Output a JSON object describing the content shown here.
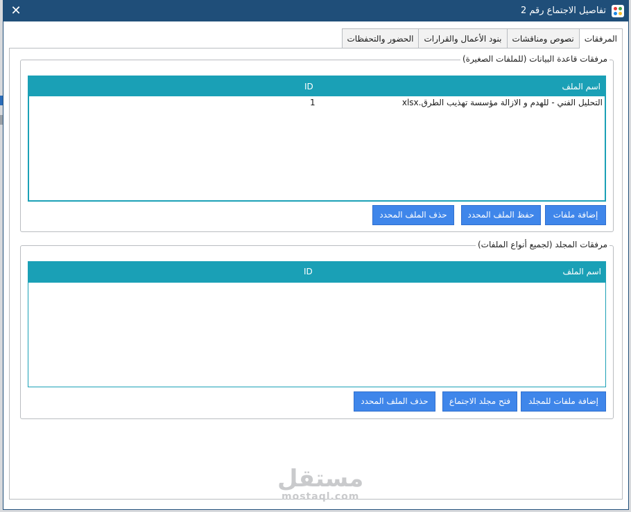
{
  "window": {
    "title": "تفاصيل الاجتماع رقم 2",
    "close_symbol": "✕",
    "app_icon": "app-dots-icon",
    "icon_colors": [
      "#e53935",
      "#43a047",
      "#1e88e5",
      "#fbc02d"
    ]
  },
  "tabs": [
    {
      "label": "المرفقات",
      "active": true
    },
    {
      "label": "نصوص ومناقشات",
      "active": false
    },
    {
      "label": "بنود الأعمال والقرارات",
      "active": false
    },
    {
      "label": "الحضور والتحفظات",
      "active": false
    }
  ],
  "db_group": {
    "legend": "مرفقات قاعدة البيانات (للملفات الصغيرة)",
    "columns": {
      "name": "اسم الملف",
      "id": "ID"
    },
    "rows": [
      {
        "name": "التحليل الفني - للهدم و الازالة مؤسسة تهذيب الطرق.xlsx",
        "id": "1"
      }
    ],
    "buttons": {
      "add": "إضافة ملفات",
      "save": "حفظ الملف المحدد",
      "delete": "حذف الملف المحدد"
    }
  },
  "folder_group": {
    "legend": "مرفقات المجلد (لجميع أنواع الملفات)",
    "columns": {
      "name": "اسم الملف",
      "id": "ID"
    },
    "rows": [],
    "buttons": {
      "add": "إضافة ملفات للمجلد",
      "open": "فتح مجلد الاجتماع",
      "delete": "حذف الملف المحدد"
    }
  },
  "watermark": {
    "arabic": "مستقل",
    "latin": "mostaql.com"
  },
  "colors": {
    "titlebar": "#1f4e79",
    "grid_header": "#1aa0b6",
    "button": "#3f86ea"
  }
}
